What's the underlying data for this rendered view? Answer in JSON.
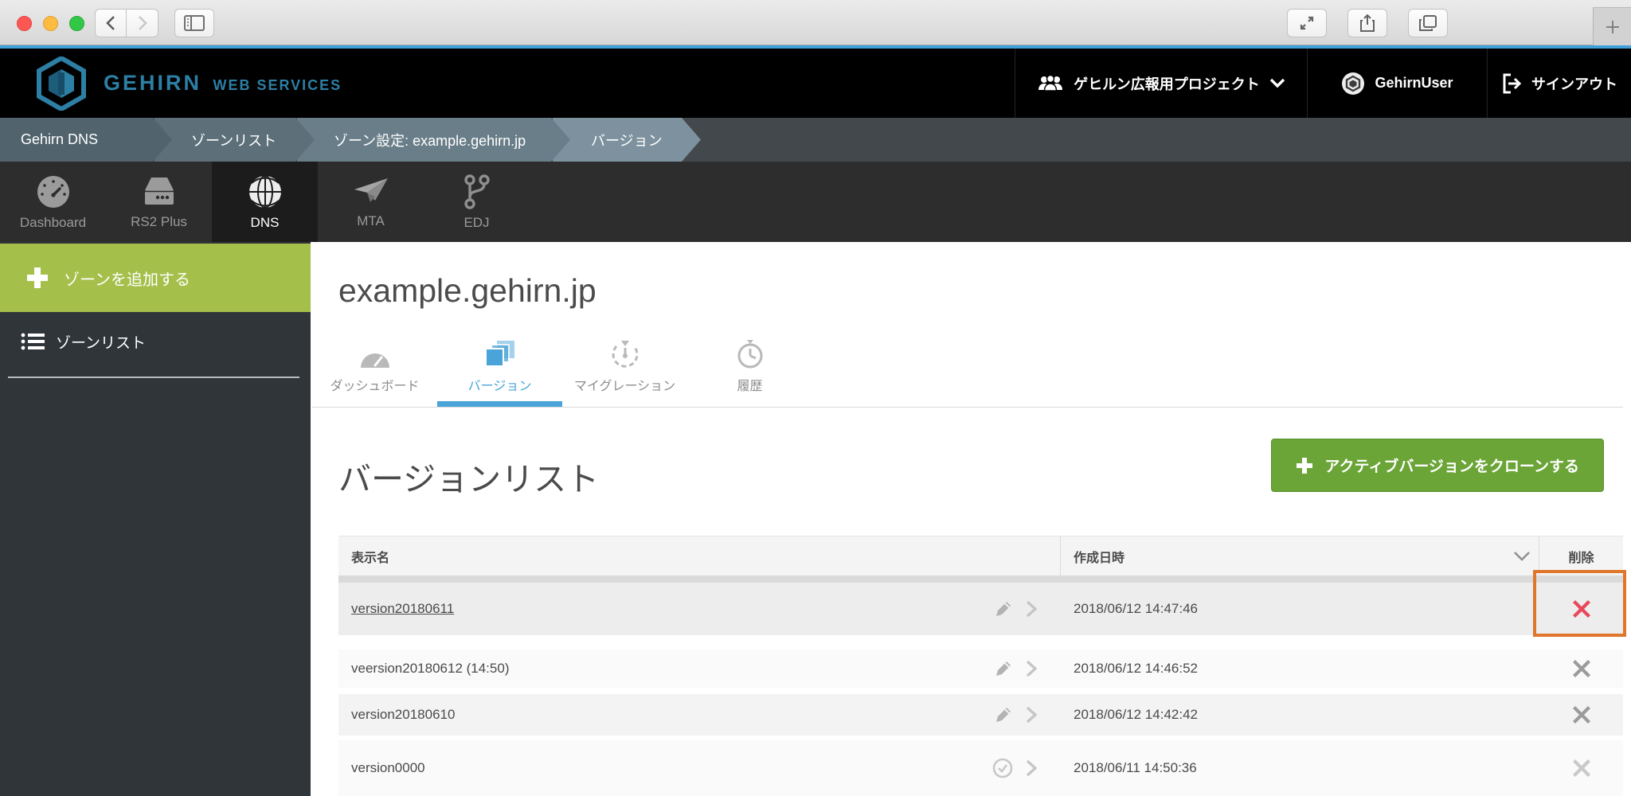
{
  "colors": {
    "accent_blue": "#3fa0da",
    "tab_active_blue": "#4aa4d9",
    "sidebar_green": "#a5bf4b",
    "button_green": "#6ba437",
    "annotation_orange": "#e0752c",
    "delete_red": "#e8485c",
    "logo_teal": "#2d7fa5"
  },
  "header": {
    "logo_primary": "GEHIRN",
    "logo_secondary": "WEB SERVICES",
    "project_selector": "ゲヒルン広報用プロジェクト",
    "user_name": "GehirnUser",
    "signout_label": "サインアウト"
  },
  "breadcrumb": {
    "items": [
      "Gehirn DNS",
      "ゾーンリスト",
      "ゾーン設定: example.gehirn.jp",
      "バージョン"
    ]
  },
  "app_nav": {
    "active": "DNS",
    "items": [
      {
        "label": "Dashboard",
        "icon": "gauge-icon"
      },
      {
        "label": "RS2 Plus",
        "icon": "server-icon"
      },
      {
        "label": "DNS",
        "icon": "globe-icon"
      },
      {
        "label": "MTA",
        "icon": "paper-plane-icon"
      },
      {
        "label": "EDJ",
        "icon": "git-branch-icon"
      }
    ]
  },
  "sidebar": {
    "add_zone_label": "ゾーンを追加する",
    "zone_list_label": "ゾーンリスト"
  },
  "main": {
    "zone_title": "example.gehirn.jp",
    "tabs": [
      {
        "label": "ダッシュボード",
        "icon": "gauge-semicircle-icon",
        "active": false
      },
      {
        "label": "バージョン",
        "icon": "stacked-versions-icon",
        "active": true
      },
      {
        "label": "マイグレーション",
        "icon": "timer-icon",
        "active": false
      },
      {
        "label": "履歴",
        "icon": "clock-icon",
        "active": false
      }
    ],
    "section_title": "バージョンリスト",
    "clone_button_label": "アクティブバージョンをクローンする",
    "table": {
      "columns": {
        "name": "表示名",
        "created": "作成日時",
        "delete": "削除"
      },
      "rows": [
        {
          "name": "version20180611",
          "created": "2018/06/12 14:47:46",
          "underlined": true,
          "row_icon": "pencil",
          "delete_style": "danger",
          "annotated": true
        },
        {
          "name": "veersion20180612 (14:50)",
          "created": "2018/06/12 14:46:52",
          "underlined": false,
          "row_icon": "pencil",
          "delete_style": "normal",
          "annotated": false
        },
        {
          "name": "version20180610",
          "created": "2018/06/12 14:42:42",
          "underlined": false,
          "row_icon": "pencil",
          "delete_style": "normal",
          "annotated": false
        },
        {
          "name": "version0000",
          "created": "2018/06/11 14:50:36",
          "underlined": false,
          "row_icon": "check",
          "delete_style": "muted",
          "annotated": false
        }
      ]
    }
  }
}
